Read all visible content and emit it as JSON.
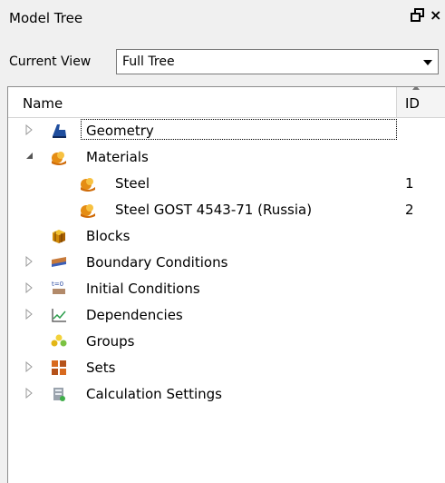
{
  "panel": {
    "title": "Model Tree",
    "float_icon": "restore-icon",
    "close_icon": "close-icon"
  },
  "view": {
    "label": "Current View",
    "value": "Full Tree"
  },
  "columns": {
    "name": "Name",
    "id": "ID"
  },
  "tree": [
    {
      "label": "Geometry",
      "id": "",
      "expander": "collapsed",
      "icon": "geometry-icon",
      "focused": true
    },
    {
      "label": "Materials",
      "id": "",
      "expander": "expanded",
      "icon": "material-icon"
    },
    {
      "label": "Steel",
      "id": "1",
      "expander": "none",
      "icon": "material-icon"
    },
    {
      "label": "Steel GOST 4543-71 (Russia)",
      "id": "2",
      "expander": "none",
      "icon": "material-icon"
    },
    {
      "label": "Blocks",
      "id": "",
      "expander": "none",
      "icon": "blocks-icon"
    },
    {
      "label": "Boundary Conditions",
      "id": "",
      "expander": "collapsed",
      "icon": "boundary-conditions-icon"
    },
    {
      "label": "Initial Conditions",
      "id": "",
      "expander": "collapsed",
      "icon": "initial-conditions-icon"
    },
    {
      "label": "Dependencies",
      "id": "",
      "expander": "collapsed",
      "icon": "dependencies-icon"
    },
    {
      "label": "Groups",
      "id": "",
      "expander": "none",
      "icon": "groups-icon"
    },
    {
      "label": "Sets",
      "id": "",
      "expander": "collapsed",
      "icon": "sets-icon"
    },
    {
      "label": "Calculation Settings",
      "id": "",
      "expander": "collapsed",
      "icon": "calculation-settings-icon"
    }
  ]
}
